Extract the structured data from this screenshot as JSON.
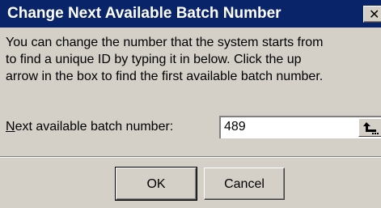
{
  "dialog": {
    "title": "Change Next Available Batch Number",
    "close_glyph": "✕",
    "description_lines": [
      "You can change the number that the system starts from",
      "to find a unique ID by typing it in below.  Click the up",
      "arrow in the box to find the first available batch number."
    ],
    "field": {
      "label_mnemonic": "N",
      "label_rest": "ext available batch number:",
      "value": "489",
      "spin_icon": "up-arrow-icon"
    },
    "buttons": {
      "ok": "OK",
      "cancel": "Cancel"
    }
  }
}
